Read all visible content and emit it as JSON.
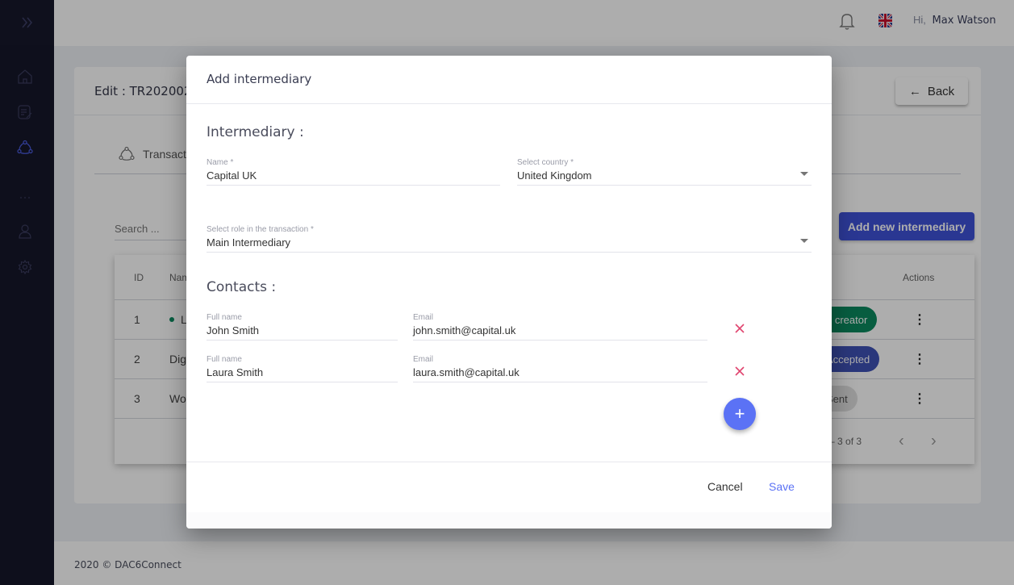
{
  "sidebar": {
    "items": [
      {
        "icon": "home-icon",
        "active": false
      },
      {
        "icon": "checklist-edit-icon",
        "active": false
      },
      {
        "icon": "network-icon",
        "active": true
      },
      {
        "icon": "more-dots-icon",
        "active": false
      },
      {
        "icon": "user-icon",
        "active": false
      },
      {
        "icon": "settings-gear-icon",
        "active": false
      }
    ],
    "toggle_icon": "double-chevron-right-icon"
  },
  "topbar": {
    "greeting": "Hi,",
    "user_name": "Max Watson",
    "language": "en-GB"
  },
  "page": {
    "title": "Edit : TR202002",
    "back_label": "Back",
    "tab_label": "Transact",
    "search_placeholder": "Search ...",
    "add_button": "Add new intermediary",
    "table": {
      "headers": {
        "id": "ID",
        "name": "Nam",
        "actions": "Actions"
      },
      "rows": [
        {
          "id": "1",
          "name": "L",
          "status": "n creator",
          "status_color": "#0b8a5f"
        },
        {
          "id": "2",
          "name": "Dig",
          "status": "Accepted",
          "status_color": "#3f51b5"
        },
        {
          "id": "3",
          "name": "Wo",
          "status": "Sent",
          "status_color": "#c4c4c4"
        }
      ],
      "pagination": "– 3 of 3"
    }
  },
  "footer": {
    "text": "2020 © DAC6Connect"
  },
  "modal": {
    "title": "Add intermediary",
    "intermediary_section": "Intermediary :",
    "name_label": "Name *",
    "name_value": "Capital UK",
    "country_label": "Select country *",
    "country_value": "United Kingdom",
    "role_label": "Select role in the transaction *",
    "role_value": "Main Intermediary",
    "contacts_section": "Contacts :",
    "contacts": [
      {
        "name_label": "Full name",
        "name": "John Smith",
        "email_label": "Email",
        "email": "john.smith@capital.uk"
      },
      {
        "name_label": "Full name",
        "name": "Laura Smith",
        "email_label": "Email",
        "email": "laura.smith@capital.uk"
      }
    ],
    "cancel_label": "Cancel",
    "save_label": "Save",
    "add_contact_label": "+"
  },
  "colors": {
    "accent": "#5b72f5",
    "primary_dark": "#3f51d8",
    "danger": "#e0456f",
    "sidebar_bg": "#16172a"
  }
}
